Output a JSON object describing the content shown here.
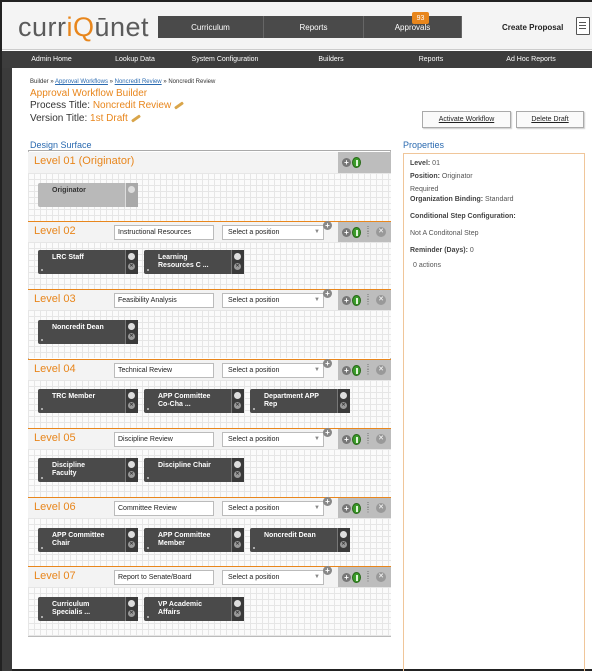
{
  "header": {
    "logo": {
      "part1": "curr",
      "part2": "iQ",
      "part3": "ūnet"
    },
    "nav": [
      "Curriculum",
      "Reports",
      "Approvals"
    ],
    "approvals_badge": "93",
    "create_proposal": "Create Proposal"
  },
  "subnav": [
    "Admin Home",
    "Lookup Data",
    "System Configuration",
    "Builders",
    "Reports",
    "Ad Hoc Reports"
  ],
  "breadcrumb": {
    "root": "Builder",
    "sep": " » ",
    "link1": "Approval Workflows",
    "link2": "Noncredit Review",
    "current": "Noncredit Review"
  },
  "page": {
    "title": "Approval Workflow Builder",
    "process_label": "Process Title: ",
    "process_value": "Noncredit Review",
    "version_label": "Version Title: ",
    "version_value": "1st Draft",
    "activate_button": "Activate Workflow",
    "delete_button": "Delete Draft"
  },
  "design_surface": {
    "title": "Design Surface",
    "select_placeholder": "Select a position",
    "levels": [
      {
        "label": "Level 01 (Originator)",
        "cards": [
          {
            "line1": "Originator",
            "line2": ""
          }
        ]
      },
      {
        "label": "Level 02",
        "name": "Instructional Resources",
        "cards": [
          {
            "line1": "LRC Staff",
            "line2": ""
          },
          {
            "line1": "Learning",
            "line2": "Resources C ..."
          }
        ]
      },
      {
        "label": "Level 03",
        "name": "Feasibility Analysis",
        "cards": [
          {
            "line1": "Noncredit Dean",
            "line2": ""
          }
        ]
      },
      {
        "label": "Level 04",
        "name": "Technical Review",
        "cards": [
          {
            "line1": "TRC Member",
            "line2": ""
          },
          {
            "line1": "APP Committee",
            "line2": "Co-Cha ..."
          },
          {
            "line1": "Department APP",
            "line2": "Rep"
          }
        ]
      },
      {
        "label": "Level 05",
        "name": "Discipline Review",
        "cards": [
          {
            "line1": "Discipline",
            "line2": "Faculty"
          },
          {
            "line1": "Discipline Chair",
            "line2": ""
          }
        ]
      },
      {
        "label": "Level 06",
        "name": "Committee Review",
        "cards": [
          {
            "line1": "APP Committee",
            "line2": "Chair"
          },
          {
            "line1": "APP Committee",
            "line2": "Member"
          },
          {
            "line1": "Noncredit Dean",
            "line2": ""
          }
        ]
      },
      {
        "label": "Level 07",
        "name": "Report to Senate/Board",
        "cards": [
          {
            "line1": "Curriculum",
            "line2": "Specialis ..."
          },
          {
            "line1": "VP Academic",
            "line2": "Affairs"
          }
        ]
      }
    ]
  },
  "properties": {
    "title": "Properties",
    "level_label": "Level:",
    "level_value": " 01",
    "position_label": "Position:",
    "position_value": " Originator",
    "required": "Required",
    "org_label": "Organization Binding:",
    "org_value": " Standard",
    "cond_label": "Conditional Step Configuration:",
    "cond_value": "Not A Conditonal Step",
    "reminder_label": "Reminder (Days):",
    "reminder_value": " 0",
    "actions": "0 actions"
  }
}
